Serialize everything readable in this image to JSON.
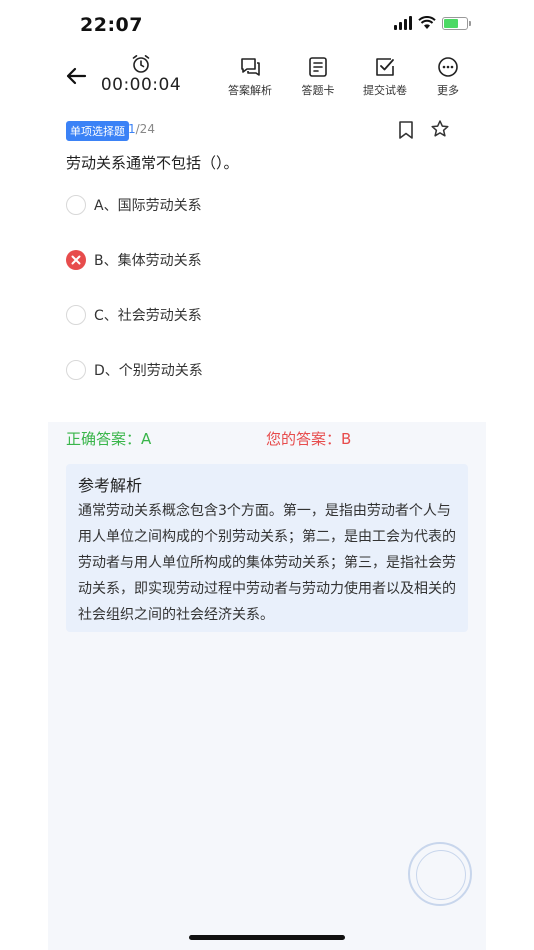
{
  "status_bar": {
    "time": "22:07"
  },
  "nav": {
    "timer": "00:00:04",
    "buttons": [
      {
        "label": "答案解析",
        "icon": "chat-icon"
      },
      {
        "label": "答题卡",
        "icon": "answer-card-icon"
      },
      {
        "label": "提交试卷",
        "icon": "submit-check-icon"
      },
      {
        "label": "更多",
        "icon": "more-dots-icon"
      }
    ]
  },
  "question": {
    "type": "单项选择题",
    "current": "1",
    "total": "/24",
    "text": "劳动关系通常不包括（）。",
    "options": [
      {
        "text": "A、国际劳动关系",
        "state": "unselected"
      },
      {
        "text": "B、集体劳动关系",
        "state": "wrong"
      },
      {
        "text": "C、社会劳动关系",
        "state": "unselected"
      },
      {
        "text": "D、个别劳动关系",
        "state": "unselected"
      }
    ]
  },
  "answers": {
    "correct": "正确答案：A",
    "yours": "您的答案：B"
  },
  "analysis": {
    "title": "参考解析",
    "body": "通常劳动关系概念包含3个方面。第一，是指由劳动者个人与用人单位之间构成的个别劳动关系；第二，是由工会为代表的劳动者与用人单位所构成的集体劳动关系；第三，是指社会劳动关系，即实现劳动过程中劳动者与劳动力使用者以及相关的社会组织之间的社会经济关系。"
  },
  "colors": {
    "accent": "#3b82f6",
    "correct": "#39b54a",
    "wrong": "#e74c4c",
    "analysis_bg": "#e9f0fb"
  }
}
